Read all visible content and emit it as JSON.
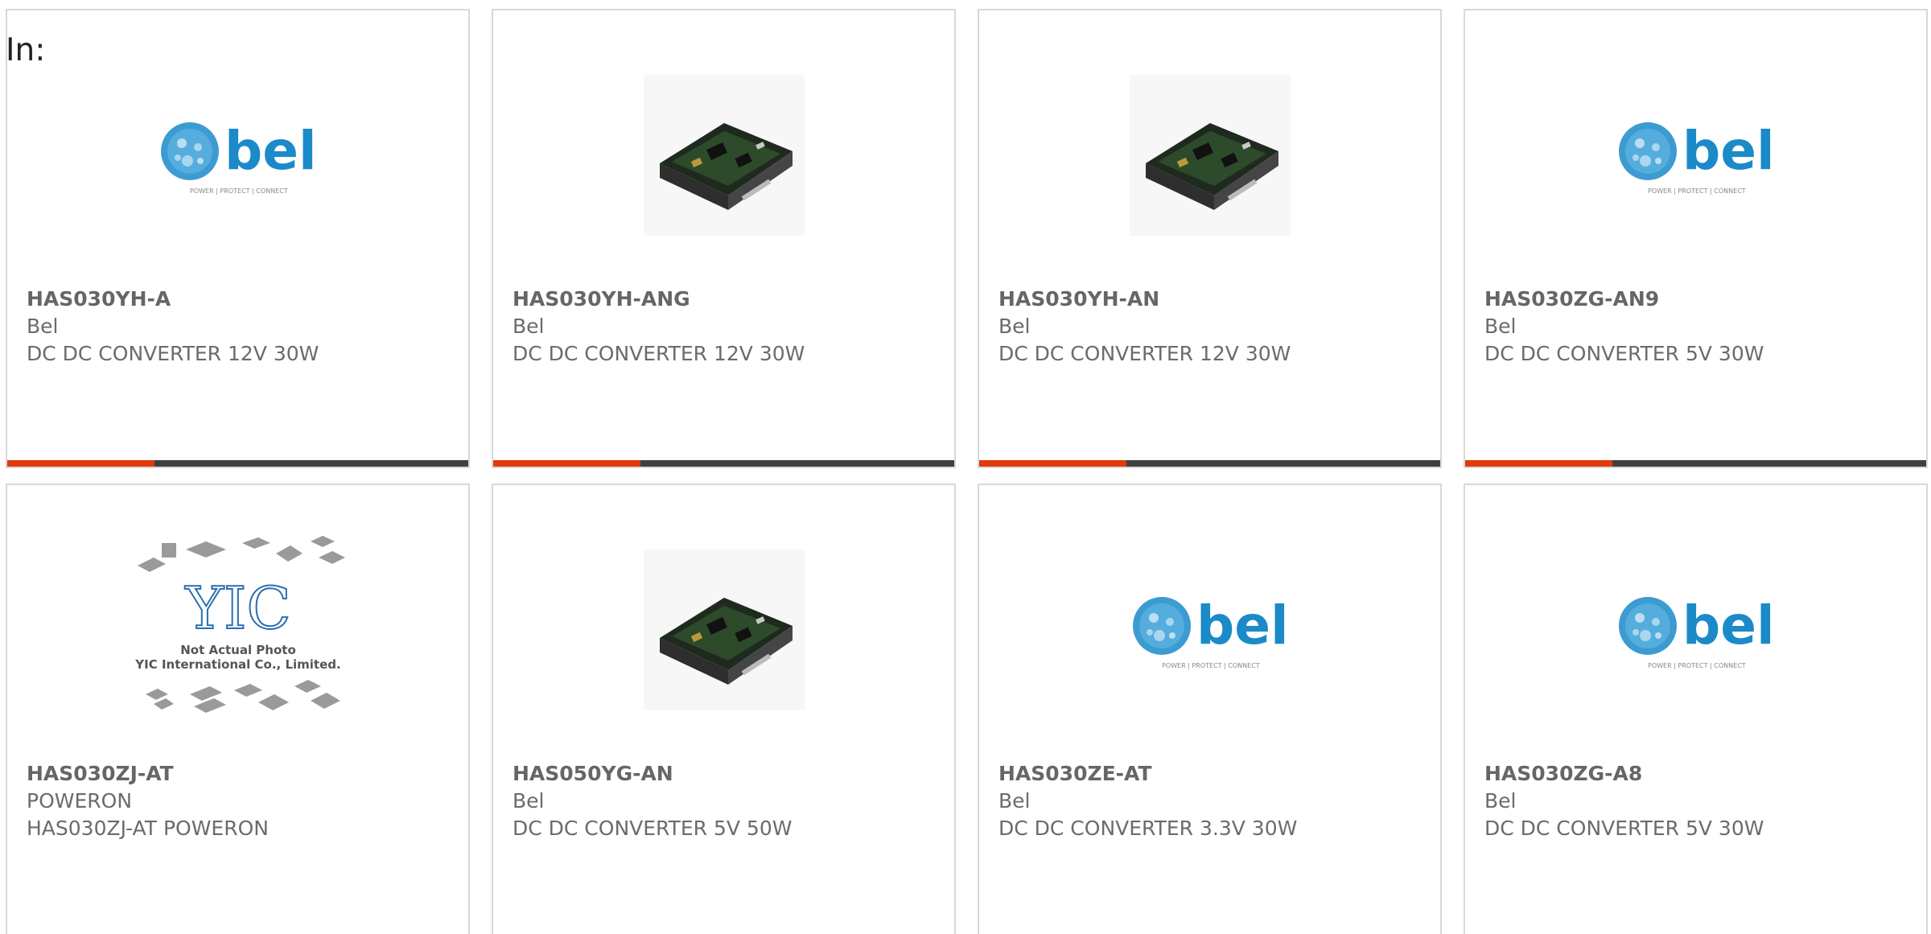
{
  "heading": "In:",
  "colors": {
    "accent": "#e03a0b",
    "bar_dark": "#404040",
    "bel_blue": "#1a8ac9",
    "card_border": "#d8d8d8",
    "text": "#6b6b6b"
  },
  "products": [
    {
      "name": "HAS030YH-A",
      "brand": "Bel",
      "description": "DC DC CONVERTER 12V 30W",
      "image": "bel-logo",
      "logo_word": "bel",
      "logo_tagline": "POWER | PROTECT | CONNECT"
    },
    {
      "name": "HAS030YH-ANG",
      "brand": "Bel",
      "description": "DC DC CONVERTER 12V 30W",
      "image": "dc-dc-module-photo"
    },
    {
      "name": "HAS030YH-AN",
      "brand": "Bel",
      "description": "DC DC CONVERTER 12V 30W",
      "image": "dc-dc-module-photo"
    },
    {
      "name": "HAS030ZG-AN9",
      "brand": "Bel",
      "description": "DC DC CONVERTER 5V 30W",
      "image": "bel-logo",
      "logo_word": "bel",
      "logo_tagline": "POWER | PROTECT | CONNECT"
    },
    {
      "name": "HAS030ZJ-AT",
      "brand": "POWERON",
      "description": "HAS030ZJ-AT POWERON",
      "image": "not-actual-photo",
      "logo_word": "YIC",
      "photo_caption_line1": "Not Actual Photo",
      "photo_caption_line2": "YIC International Co., Limited."
    },
    {
      "name": "HAS050YG-AN",
      "brand": "Bel",
      "description": "DC DC CONVERTER 5V 50W",
      "image": "dc-dc-module-photo"
    },
    {
      "name": "HAS030ZE-AT",
      "brand": "Bel",
      "description": "DC DC CONVERTER 3.3V 30W",
      "image": "bel-logo",
      "logo_word": "bel",
      "logo_tagline": "POWER | PROTECT | CONNECT"
    },
    {
      "name": "HAS030ZG-A8",
      "brand": "Bel",
      "description": "DC DC CONVERTER 5V 30W",
      "image": "bel-logo",
      "logo_word": "bel",
      "logo_tagline": "POWER | PROTECT | CONNECT"
    }
  ]
}
